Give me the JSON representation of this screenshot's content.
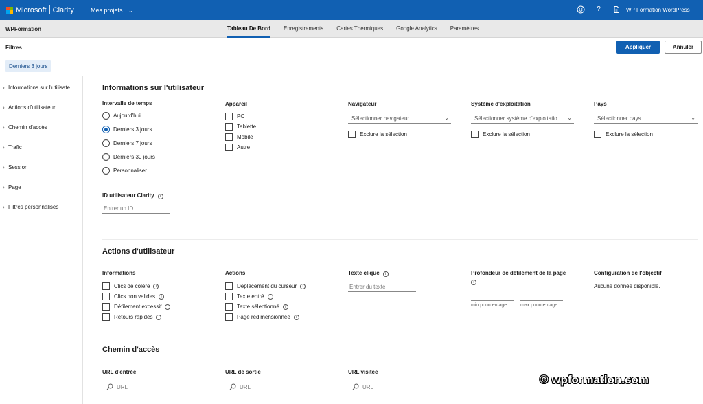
{
  "colors": {
    "topbar": "#1160b2",
    "accent": "#1160b2",
    "navbar": "#e9e9e9"
  },
  "topbar": {
    "brand_ms": "Microsoft",
    "brand_product": "Clarity",
    "projects_label": "Mes projets",
    "site_name": "WP Formation WordPress",
    "icons": [
      "smiley-icon",
      "help-icon",
      "document-icon"
    ]
  },
  "nav": {
    "project": "WPFormation",
    "tabs": [
      "Tableau De Bord",
      "Enregistrements",
      "Cartes Thermiques",
      "Google Analytics",
      "Paramètres"
    ],
    "active_tab": "Tableau De Bord"
  },
  "filters": {
    "title": "Filtres",
    "apply": "Appliquer",
    "cancel": "Annuler",
    "chip": "Derniers 3 jours"
  },
  "sidebar": {
    "items": [
      "Informations sur l'utilisate...",
      "Actions d'utilisateur",
      "Chemin d'accès",
      "Trafic",
      "Session",
      "Page",
      "Filtres personnalisés"
    ]
  },
  "user_info": {
    "title": "Informations sur l'utilisateur",
    "time": {
      "label": "Intervalle de temps",
      "options": [
        "Aujourd'hui",
        "Derniers 3 jours",
        "Derniers 7 jours",
        "Derniers 30 jours",
        "Personnaliser"
      ],
      "selected": "Derniers 3 jours"
    },
    "device": {
      "label": "Appareil",
      "options": [
        "PC",
        "Tablette",
        "Mobile",
        "Autre"
      ]
    },
    "browser": {
      "label": "Navigateur",
      "placeholder": "Sélectionner navigateur",
      "exclude": "Exclure la sélection"
    },
    "os": {
      "label": "Système d'exploitation",
      "placeholder": "Sélectionner système d'exploitatio...",
      "exclude": "Exclure la sélection"
    },
    "country": {
      "label": "Pays",
      "placeholder": "Sélectionner pays",
      "exclude": "Exclure la sélection"
    },
    "clarity_id": {
      "label": "ID utilisateur Clarity",
      "placeholder": "Entrer un ID"
    }
  },
  "user_actions": {
    "title": "Actions d'utilisateur",
    "informations": {
      "label": "Informations",
      "options": [
        "Clics de colère",
        "Clics non valides",
        "Défilement excessif",
        "Retours rapides"
      ]
    },
    "actions": {
      "label": "Actions",
      "options": [
        "Déplacement du curseur",
        "Texte entré",
        "Texte sélectionné",
        "Page redimensionnée"
      ]
    },
    "clicked_text": {
      "label": "Texte cliqué",
      "placeholder": "Entrer du texte"
    },
    "scroll_depth": {
      "label": "Profondeur de défilement de la page",
      "min": "min pourcentage",
      "max": "max pourcentage"
    },
    "goal": {
      "label": "Configuration de l'objectif",
      "value": "Aucune donnée disponible."
    }
  },
  "path": {
    "title": "Chemin d'accès",
    "entry": {
      "label": "URL d'entrée",
      "placeholder": "URL"
    },
    "exit": {
      "label": "URL de sortie",
      "placeholder": "URL"
    },
    "visited": {
      "label": "URL visitée",
      "placeholder": "URL"
    }
  },
  "watermark": "© wpformation.com"
}
